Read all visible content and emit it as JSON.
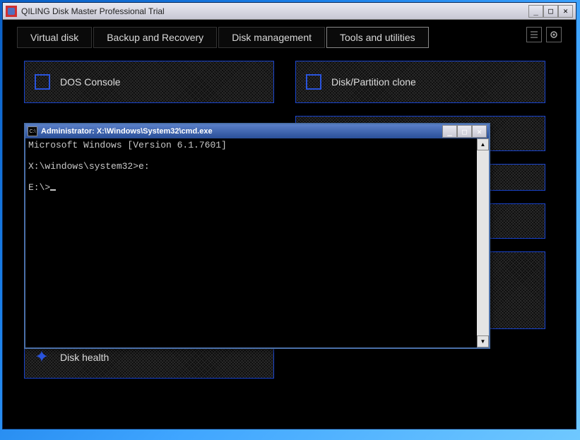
{
  "main": {
    "title": "QILING Disk Master Professional Trial",
    "tabs": [
      "Virtual disk",
      "Backup and Recovery",
      "Disk management",
      "Tools and utilities"
    ],
    "active_tab": 3,
    "left_panels": [
      {
        "label": "DOS Console",
        "icon": "square"
      },
      {
        "label": "Disk health",
        "icon": "gear"
      }
    ],
    "right_panels": [
      {
        "label": "Disk/Partition clone",
        "icon": "square"
      }
    ]
  },
  "cmd": {
    "title": "Administrator: X:\\Windows\\System32\\cmd.exe",
    "lines": "Microsoft Windows [Version 6.1.7601]\n\nX:\\windows\\system32>e:\n\nE:\\>"
  },
  "winctl": {
    "min": "_",
    "max": "□",
    "close": "✕"
  }
}
